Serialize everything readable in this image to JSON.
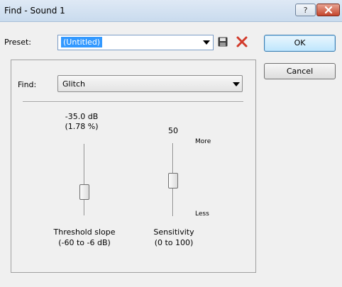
{
  "window": {
    "title": "Find - Sound 1",
    "help_label": "?",
    "close_icon": "close-icon"
  },
  "preset": {
    "label": "Preset:",
    "value": "(Untitled)",
    "save_icon": "save-icon",
    "delete_icon": "delete-icon"
  },
  "buttons": {
    "ok": "OK",
    "cancel": "Cancel"
  },
  "find": {
    "label": "Find:",
    "value": "Glitch"
  },
  "threshold": {
    "value_line1": "-35.0 dB",
    "value_line2": "(1.78 %)",
    "label_line1": "Threshold slope",
    "label_line2": "(-60 to -6 dB)",
    "range_db": [
      -60,
      -6
    ],
    "value_db": -35.0
  },
  "sensitivity": {
    "value": "50",
    "more_label": "More",
    "less_label": "Less",
    "label_line1": "Sensitivity",
    "label_line2": "(0 to 100)",
    "range": [
      0,
      100
    ]
  },
  "colors": {
    "selection": "#3399ff",
    "close_red": "#c5452c",
    "delete_red": "#d23a2a"
  }
}
